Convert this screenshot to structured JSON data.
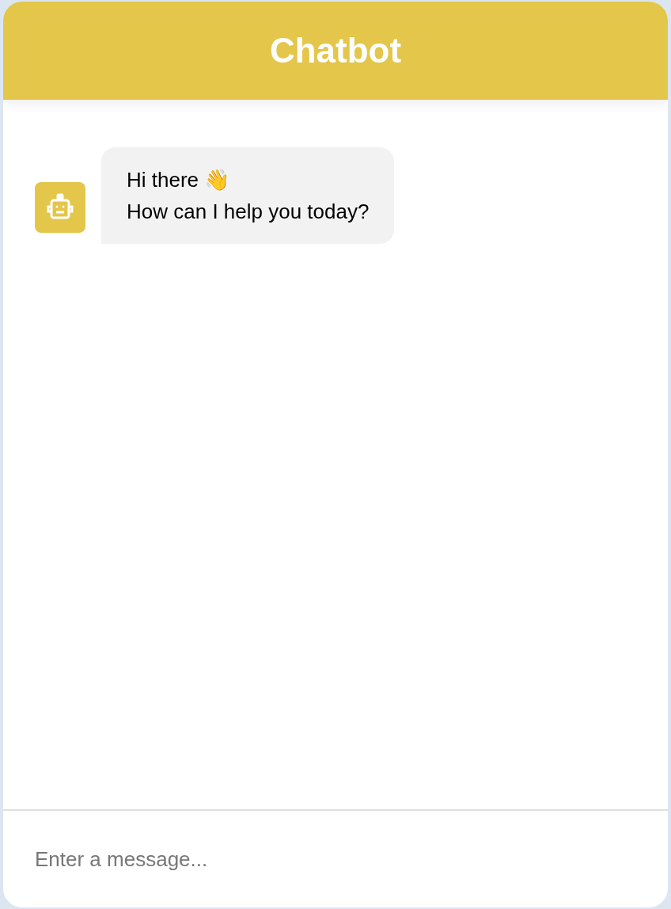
{
  "header": {
    "title": "Chatbot"
  },
  "messages": [
    {
      "kind": "bot",
      "lines": [
        "Hi there 👋",
        "How can I help you today?"
      ]
    }
  ],
  "composer": {
    "placeholder": "Enter a message..."
  }
}
